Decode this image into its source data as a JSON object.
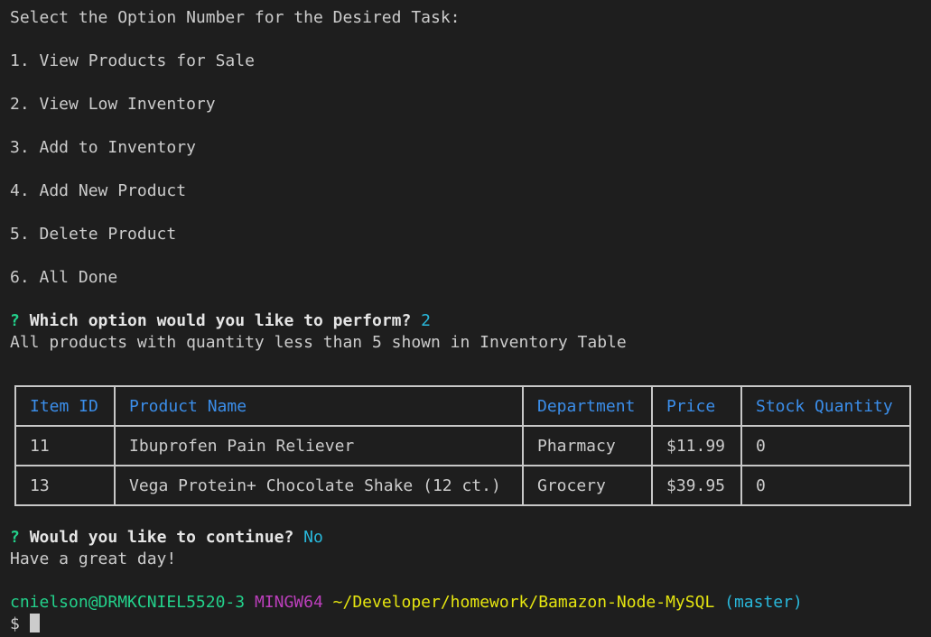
{
  "menu": {
    "prompt": "Select the Option Number for the Desired Task:",
    "options": [
      "1. View Products for Sale",
      "2. View Low Inventory",
      "3. Add to Inventory",
      "4. Add New Product",
      "5. Delete Product",
      "6. All Done"
    ]
  },
  "question1": {
    "mark": "?",
    "text": "Which option would you like to perform?",
    "answer": "2"
  },
  "info_line": "All products with quantity less than 5 shown in Inventory Table",
  "table": {
    "headers": [
      "Item ID",
      "Product Name",
      "Department",
      "Price",
      "Stock Quantity"
    ],
    "rows": [
      [
        "11",
        "Ibuprofen Pain Reliever",
        "Pharmacy",
        "$11.99",
        "0"
      ],
      [
        "13",
        "Vega Protein+ Chocolate Shake (12 ct.)",
        "Grocery",
        "$39.95",
        "0"
      ]
    ]
  },
  "question2": {
    "mark": "?",
    "text": "Would you like to continue?",
    "answer": "No"
  },
  "farewell": "Have a great day!",
  "prompt_line": {
    "user_host": "cnielson@DRMKCNIEL5520-3",
    "system": "MINGW64",
    "path": "~/Developer/homework/Bamazon-Node-MySQL",
    "branch": "(master)",
    "symbol": "$"
  },
  "colors": {
    "background": "#1e1e1e",
    "text": "#cccccc",
    "header_blue": "#3b8eea",
    "answer_cyan": "#29b8db",
    "green": "#23d18b",
    "magenta": "#bc3fbc",
    "yellow": "#e5e510"
  }
}
